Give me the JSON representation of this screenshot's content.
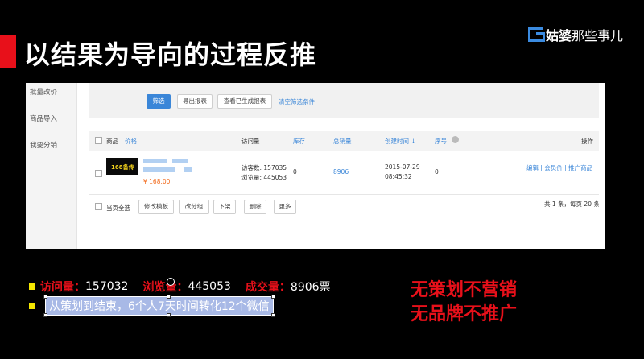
{
  "title": "以结果为导向的过程反推",
  "brand": {
    "name_bold": "姑婆",
    "name_light": "那些事儿"
  },
  "admin": {
    "sidebar": [
      "批量改价",
      "商品导入",
      "我要分销"
    ],
    "filter_buttons": {
      "filter": "筛选",
      "export": "导出报表",
      "view_reports": "查看已生成报表",
      "clear": "清空筛选条件"
    },
    "columns": {
      "product": "商品",
      "price": "价格",
      "visits": "访问量",
      "stock": "库存",
      "total_sales": "总销量",
      "created": "创建时间 ↓",
      "seq": "序号",
      "ops": "操作"
    },
    "row": {
      "thumb_text": "168备传",
      "price": "¥ 168.00",
      "visitors": "访客数: 157035",
      "views": "浏览量: 445053",
      "stock": "0",
      "sales": "8906",
      "date": "2015-07-29",
      "time": "08:45:32",
      "seq": "0",
      "ops": "编辑 | 会员价 | 推广商品"
    },
    "bottom": {
      "select_all": "当页全选",
      "edit_template": "修改模板",
      "change_group": "改分组",
      "off_shelf": "下架",
      "delete": "删除",
      "more": "更多",
      "pager": "共 1 条，每页 20 条"
    }
  },
  "stats": [
    {
      "label": "访问量：",
      "value": "157032"
    },
    {
      "label": "浏览量：",
      "value": "445053"
    },
    {
      "label": "成交量：",
      "value": "8906票"
    }
  ],
  "selected_text": "从策划到结束，6个人7天时间转化12个微信",
  "slogans": [
    "无策划不营销",
    "无品牌不推广"
  ],
  "colors": {
    "accent_red": "#e8101a",
    "link_blue": "#3a86d8",
    "marker_yellow": "#f3e600"
  }
}
